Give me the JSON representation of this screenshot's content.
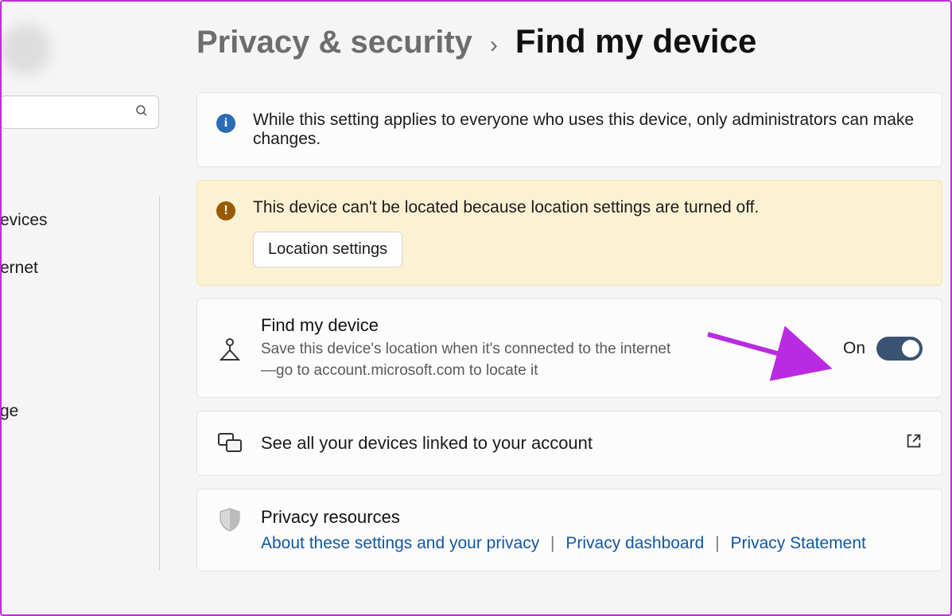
{
  "sidebar": {
    "items": [
      {
        "label": "evices"
      },
      {
        "label": "ernet"
      },
      {
        "label": ""
      },
      {
        "label": ""
      },
      {
        "label": "ge"
      }
    ]
  },
  "breadcrumb": {
    "parent": "Privacy & security",
    "separator": "›",
    "current": "Find my device"
  },
  "info_banner": {
    "text": "While this setting applies to everyone who uses this device, only administrators can make changes."
  },
  "warn_banner": {
    "text": "This device can't be located because location settings are turned off.",
    "button": "Location settings"
  },
  "find_device": {
    "title": "Find my device",
    "desc": "Save this device's location when it's connected to the internet—go to account.microsoft.com to locate it",
    "state_label": "On"
  },
  "linked_devices": {
    "text": "See all your devices linked to your account"
  },
  "resources": {
    "title": "Privacy resources",
    "link1": "About these settings and your privacy",
    "link2": "Privacy dashboard",
    "link3": "Privacy Statement"
  }
}
